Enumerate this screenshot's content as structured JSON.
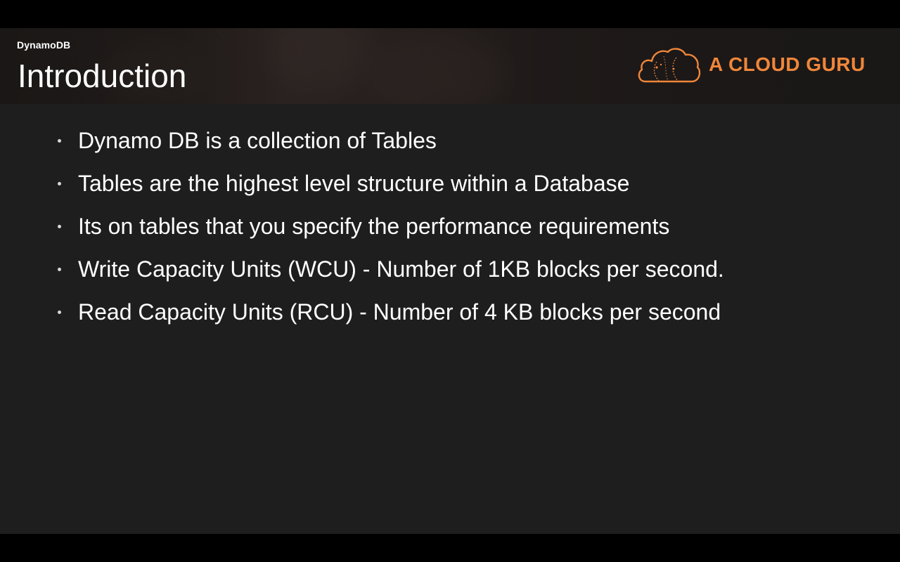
{
  "slide": {
    "section": "DynamoDB",
    "title": "Introduction",
    "bullets": [
      "Dynamo DB is a collection of Tables",
      "Tables are the highest level structure within a Database",
      "Its on tables that you specify the performance requirements",
      "Write Capacity Units (WCU) - Number of 1KB blocks per second.",
      "Read Capacity Units (RCU) - Number of 4 KB blocks per second"
    ]
  },
  "brand": {
    "name": "A CLOUD GURU",
    "icon": "cloud-icon",
    "color": "#f0863a"
  },
  "colors": {
    "background": "#1e1e1e",
    "letterbox": "#000000",
    "text": "#ffffff"
  }
}
